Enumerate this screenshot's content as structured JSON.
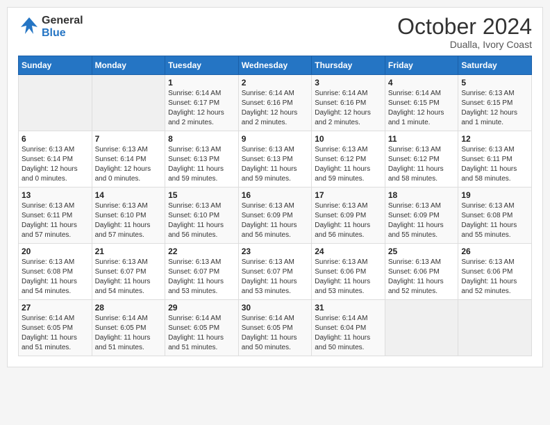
{
  "header": {
    "logo_general": "General",
    "logo_blue": "Blue",
    "month_title": "October 2024",
    "location": "Dualla, Ivory Coast"
  },
  "calendar": {
    "days_of_week": [
      "Sunday",
      "Monday",
      "Tuesday",
      "Wednesday",
      "Thursday",
      "Friday",
      "Saturday"
    ],
    "weeks": [
      [
        {
          "day": "",
          "info": ""
        },
        {
          "day": "",
          "info": ""
        },
        {
          "day": "1",
          "info": "Sunrise: 6:14 AM\nSunset: 6:17 PM\nDaylight: 12 hours\nand 2 minutes."
        },
        {
          "day": "2",
          "info": "Sunrise: 6:14 AM\nSunset: 6:16 PM\nDaylight: 12 hours\nand 2 minutes."
        },
        {
          "day": "3",
          "info": "Sunrise: 6:14 AM\nSunset: 6:16 PM\nDaylight: 12 hours\nand 2 minutes."
        },
        {
          "day": "4",
          "info": "Sunrise: 6:14 AM\nSunset: 6:15 PM\nDaylight: 12 hours\nand 1 minute."
        },
        {
          "day": "5",
          "info": "Sunrise: 6:13 AM\nSunset: 6:15 PM\nDaylight: 12 hours\nand 1 minute."
        }
      ],
      [
        {
          "day": "6",
          "info": "Sunrise: 6:13 AM\nSunset: 6:14 PM\nDaylight: 12 hours\nand 0 minutes."
        },
        {
          "day": "7",
          "info": "Sunrise: 6:13 AM\nSunset: 6:14 PM\nDaylight: 12 hours\nand 0 minutes."
        },
        {
          "day": "8",
          "info": "Sunrise: 6:13 AM\nSunset: 6:13 PM\nDaylight: 11 hours\nand 59 minutes."
        },
        {
          "day": "9",
          "info": "Sunrise: 6:13 AM\nSunset: 6:13 PM\nDaylight: 11 hours\nand 59 minutes."
        },
        {
          "day": "10",
          "info": "Sunrise: 6:13 AM\nSunset: 6:12 PM\nDaylight: 11 hours\nand 59 minutes."
        },
        {
          "day": "11",
          "info": "Sunrise: 6:13 AM\nSunset: 6:12 PM\nDaylight: 11 hours\nand 58 minutes."
        },
        {
          "day": "12",
          "info": "Sunrise: 6:13 AM\nSunset: 6:11 PM\nDaylight: 11 hours\nand 58 minutes."
        }
      ],
      [
        {
          "day": "13",
          "info": "Sunrise: 6:13 AM\nSunset: 6:11 PM\nDaylight: 11 hours\nand 57 minutes."
        },
        {
          "day": "14",
          "info": "Sunrise: 6:13 AM\nSunset: 6:10 PM\nDaylight: 11 hours\nand 57 minutes."
        },
        {
          "day": "15",
          "info": "Sunrise: 6:13 AM\nSunset: 6:10 PM\nDaylight: 11 hours\nand 56 minutes."
        },
        {
          "day": "16",
          "info": "Sunrise: 6:13 AM\nSunset: 6:09 PM\nDaylight: 11 hours\nand 56 minutes."
        },
        {
          "day": "17",
          "info": "Sunrise: 6:13 AM\nSunset: 6:09 PM\nDaylight: 11 hours\nand 56 minutes."
        },
        {
          "day": "18",
          "info": "Sunrise: 6:13 AM\nSunset: 6:09 PM\nDaylight: 11 hours\nand 55 minutes."
        },
        {
          "day": "19",
          "info": "Sunrise: 6:13 AM\nSunset: 6:08 PM\nDaylight: 11 hours\nand 55 minutes."
        }
      ],
      [
        {
          "day": "20",
          "info": "Sunrise: 6:13 AM\nSunset: 6:08 PM\nDaylight: 11 hours\nand 54 minutes."
        },
        {
          "day": "21",
          "info": "Sunrise: 6:13 AM\nSunset: 6:07 PM\nDaylight: 11 hours\nand 54 minutes."
        },
        {
          "day": "22",
          "info": "Sunrise: 6:13 AM\nSunset: 6:07 PM\nDaylight: 11 hours\nand 53 minutes."
        },
        {
          "day": "23",
          "info": "Sunrise: 6:13 AM\nSunset: 6:07 PM\nDaylight: 11 hours\nand 53 minutes."
        },
        {
          "day": "24",
          "info": "Sunrise: 6:13 AM\nSunset: 6:06 PM\nDaylight: 11 hours\nand 53 minutes."
        },
        {
          "day": "25",
          "info": "Sunrise: 6:13 AM\nSunset: 6:06 PM\nDaylight: 11 hours\nand 52 minutes."
        },
        {
          "day": "26",
          "info": "Sunrise: 6:13 AM\nSunset: 6:06 PM\nDaylight: 11 hours\nand 52 minutes."
        }
      ],
      [
        {
          "day": "27",
          "info": "Sunrise: 6:14 AM\nSunset: 6:05 PM\nDaylight: 11 hours\nand 51 minutes."
        },
        {
          "day": "28",
          "info": "Sunrise: 6:14 AM\nSunset: 6:05 PM\nDaylight: 11 hours\nand 51 minutes."
        },
        {
          "day": "29",
          "info": "Sunrise: 6:14 AM\nSunset: 6:05 PM\nDaylight: 11 hours\nand 51 minutes."
        },
        {
          "day": "30",
          "info": "Sunrise: 6:14 AM\nSunset: 6:05 PM\nDaylight: 11 hours\nand 50 minutes."
        },
        {
          "day": "31",
          "info": "Sunrise: 6:14 AM\nSunset: 6:04 PM\nDaylight: 11 hours\nand 50 minutes."
        },
        {
          "day": "",
          "info": ""
        },
        {
          "day": "",
          "info": ""
        }
      ]
    ]
  }
}
